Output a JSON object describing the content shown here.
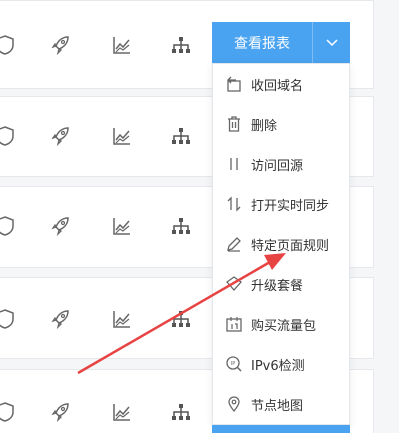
{
  "actions": {
    "view_report_label": "查看报表",
    "caret_icon": "chevron-down-icon",
    "accent_color": "#4aa3f0"
  },
  "dropdown": {
    "items": [
      {
        "label": "收回域名",
        "icon": "reclaim-domain-icon"
      },
      {
        "label": "删除",
        "icon": "trash-icon"
      },
      {
        "label": "访问回源",
        "icon": "origin-fetch-icon"
      },
      {
        "label": "打开实时同步",
        "icon": "sync-icon"
      },
      {
        "label": "特定页面规则",
        "icon": "edit-pencil-icon"
      },
      {
        "label": "升级套餐",
        "icon": "upgrade-diamond-icon"
      },
      {
        "label": "购买流量包",
        "icon": "traffic-package-icon"
      },
      {
        "label": "IPv6检测",
        "icon": "ipv6-check-icon"
      },
      {
        "label": "节点地图",
        "icon": "location-pin-icon"
      }
    ]
  },
  "row_icons": [
    "shield-icon",
    "rocket-icon",
    "trend-chart-icon",
    "sitemap-icon"
  ],
  "annotation": {
    "color": "#e84343",
    "icon": "annotation-arrow"
  }
}
